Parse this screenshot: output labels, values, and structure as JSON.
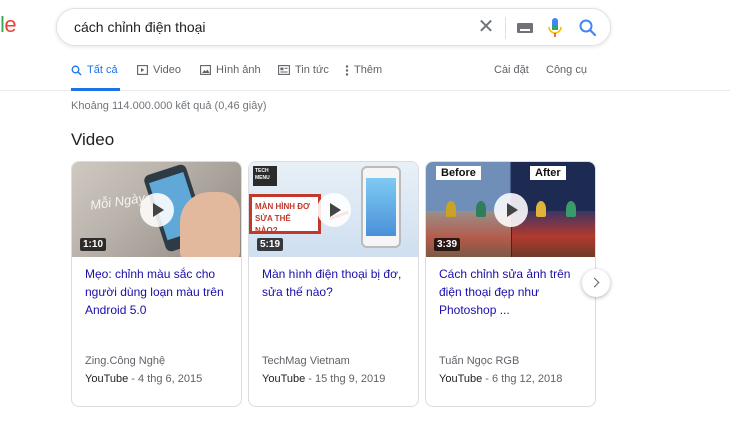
{
  "logo": {
    "part1": "l",
    "part2": "e"
  },
  "search": {
    "query": "cách chỉnh điện thoại"
  },
  "tabs": [
    {
      "label": "Tất cả",
      "icon": "search-icon",
      "active": true
    },
    {
      "label": "Video",
      "icon": "video-icon"
    },
    {
      "label": "Hình ảnh",
      "icon": "image-icon"
    },
    {
      "label": "Tin tức",
      "icon": "news-icon"
    },
    {
      "label": "Thêm",
      "icon": "more-vert-icon"
    }
  ],
  "tools": {
    "settings": "Cài đặt",
    "tools": "Công cụ"
  },
  "result_stats": "Khoảng 114.000.000 kết quả (0,46 giây)",
  "video_section": {
    "title": "Video",
    "cards": [
      {
        "duration": "1:10",
        "title": "Mẹo: chỉnh màu sắc cho người dùng loạn màu trên Android 5.0",
        "source": "Zing.Công Nghệ",
        "platform": "YouTube",
        "date": "4 thg 6, 2015"
      },
      {
        "duration": "5:19",
        "title": "Màn hình điện thoại bị đơ, sửa thế nào?",
        "source": "TechMag Vietnam",
        "platform": "YouTube",
        "date": "15 thg 9, 2019",
        "thumb_badge": "TECH MENU",
        "thumb_banner": "MÀN HÌNH ĐƠ SỬA THẾ NÀO?"
      },
      {
        "duration": "3:39",
        "title": "Cách chỉnh sửa ảnh trên điện thoại đẹp như Photoshop ...",
        "source": "Tuấn Ngọc RGB",
        "platform": "YouTube",
        "date": "6 thg 12, 2018",
        "thumb_before": "Before",
        "thumb_after": "After"
      }
    ]
  },
  "colors": {
    "link": "#1a0dab",
    "accent": "#1a73e8",
    "meta": "#5f6368"
  }
}
